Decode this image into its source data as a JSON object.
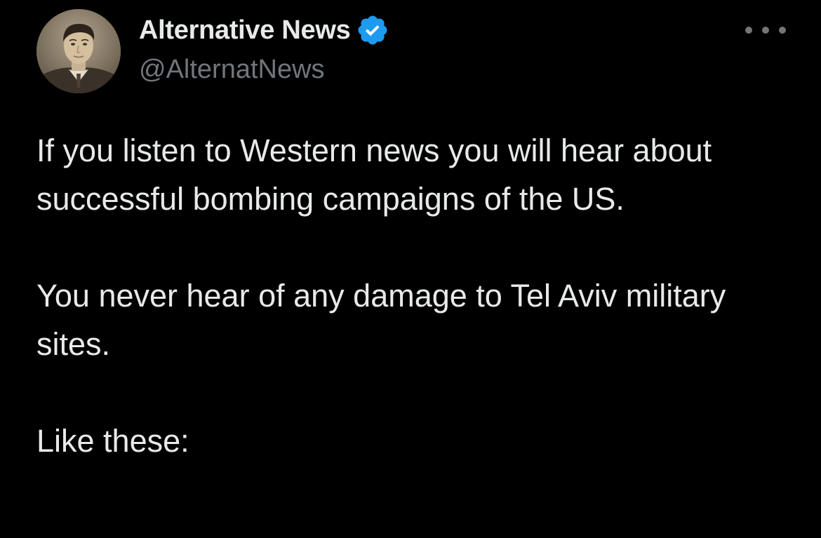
{
  "author": {
    "name": "Alternative News",
    "handle": "@AlternatNews",
    "verified": true,
    "avatar_icon": "vintage-portrait-avatar",
    "verified_icon": "verified-check-badge-icon"
  },
  "menu": {
    "more_icon": "more-options-icon"
  },
  "tweet": {
    "paragraphs": [
      "If you listen to Western news you will hear about successful bombing campaigns of the US.",
      "You never hear of any damage to Tel Aviv military sites.",
      "Like these:"
    ]
  },
  "colors": {
    "background": "#000000",
    "text_primary": "#e7e9ea",
    "text_secondary": "#71767b",
    "verified_blue": "#1d9bf0"
  }
}
